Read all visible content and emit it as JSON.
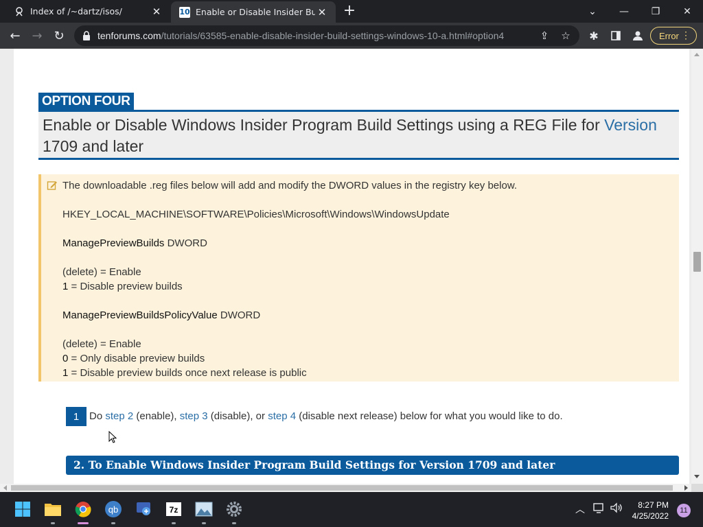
{
  "browser": {
    "tabs": [
      {
        "title": "Index of /~dartz/isos/",
        "active": false
      },
      {
        "title": "Enable or Disable Insider Build Se",
        "active": true
      }
    ],
    "url_host": "tenforums.com",
    "url_path": "/tutorials/63585-enable-disable-insider-build-settings-windows-10-a.html#option4",
    "error_label": "Error"
  },
  "article": {
    "option_label": "OPTION FOUR",
    "heading_main": "Enable or Disable Windows Insider Program Build Settings using a REG File for ",
    "heading_link": "Version",
    "heading_tail": "1709 and later",
    "note": {
      "intro": "The downloadable .reg files below will add and modify the DWORD values in the registry key below.",
      "reg_key": "HKEY_LOCAL_MACHINE\\SOFTWARE\\Policies\\Microsoft\\Windows\\WindowsUpdate",
      "value1_name": "ManagePreviewBuilds",
      "value1_type": " DWORD",
      "v1_line1": "(delete) = Enable",
      "v1_line2_key": "1",
      "v1_line2_val": " = Disable preview builds",
      "value2_name": "ManagePreviewBuildsPolicyValue",
      "value2_type": " DWORD",
      "v2_line1": "(delete) = Enable",
      "v2_line2_key": "0",
      "v2_line2_val": " = Only disable preview builds",
      "v2_line3_key": "1",
      "v2_line3_val": " = Disable preview builds once next release is public"
    },
    "step1": {
      "number": "1",
      "t1": "Do ",
      "link1": "step 2",
      "t2": " (enable), ",
      "link2": "step 3",
      "t3": " (disable), or ",
      "link3": "step 4",
      "t4": " (disable next release) below for what you would like to do."
    },
    "section2_title": "2. To Enable Windows Insider Program Build Settings for Version 1709 and later"
  },
  "taskbar": {
    "time": "8:27 PM",
    "date": "4/25/2022",
    "notifications": "11",
    "apps": [
      "start-icon",
      "file-explorer-icon",
      "chrome-icon",
      "qbittorrent-icon",
      "remote-desktop-icon",
      "7zip-icon",
      "photos-icon",
      "settings-icon"
    ]
  },
  "colors": {
    "accent": "#0a5a9c",
    "link": "#2a6ea6",
    "note_bg": "#fdf3dc",
    "note_border": "#f2c56a"
  }
}
